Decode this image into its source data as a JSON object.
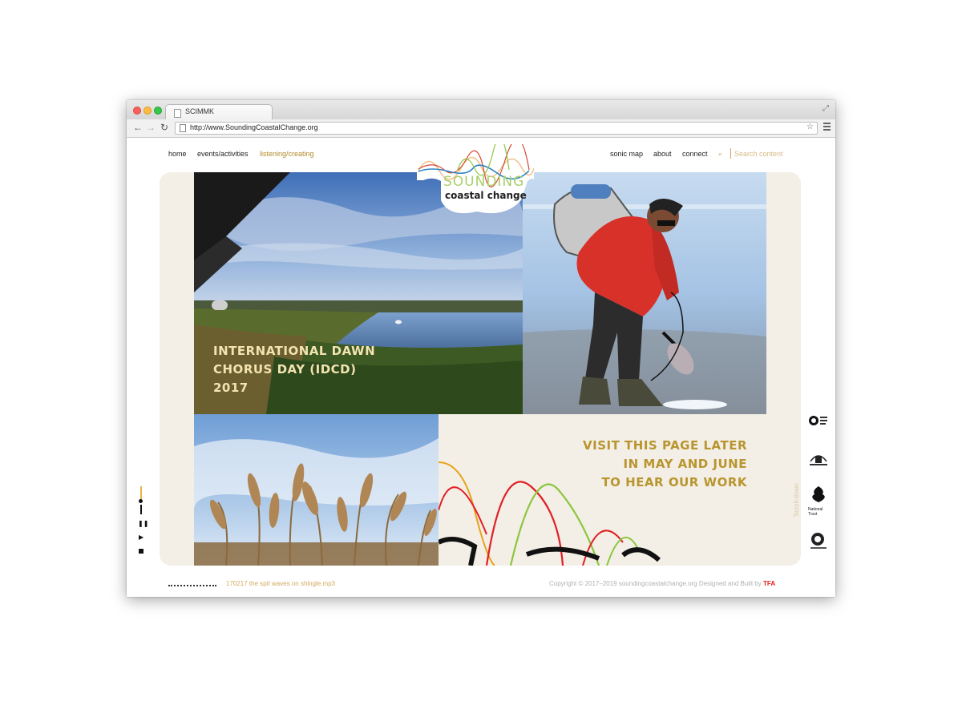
{
  "browser": {
    "tab_title": "SCIMMK",
    "url": "http://www.SoundingCoastalChange.org"
  },
  "nav": {
    "left": [
      {
        "label": "home",
        "active": false
      },
      {
        "label": "events/activities",
        "active": false
      },
      {
        "label": "listening/creating",
        "active": true
      }
    ],
    "right": [
      {
        "label": "sonic map"
      },
      {
        "label": "about"
      },
      {
        "label": "connect"
      }
    ],
    "search_placeholder": "Search content"
  },
  "logo": {
    "word1": "SOUNDING",
    "word2": "coastal change"
  },
  "tiles": {
    "idcd_title_lines": [
      "INTERNATIONAL DAWN",
      "CHORUS DAY (IDCD)",
      "2017"
    ],
    "visit_lines": [
      "VISIT THIS PAGE LATER",
      "IN MAY AND JUNE",
      "TO HEAR OUR WORK"
    ]
  },
  "sidebar_text": "Scroll-down",
  "partner_logos": [
    {
      "name": "The Open University"
    },
    {
      "name": "Dundee"
    },
    {
      "name": "National Trust",
      "label": "National\nTrust"
    },
    {
      "name": "Arts & Humanities Research Council"
    }
  ],
  "player": {
    "track": "170217 the spit waves on shingle.mp3"
  },
  "footer": {
    "copyright": "Copyright © 2017–2019 soundingcoastalchange.org Designed and Built by",
    "brand": "TFA"
  },
  "colors": {
    "accent": "#b28b2b",
    "panel": "#f3efe6",
    "headline": "#b8952e",
    "overlay_text": "#f3e3b0",
    "tfa": "#e0201d"
  }
}
